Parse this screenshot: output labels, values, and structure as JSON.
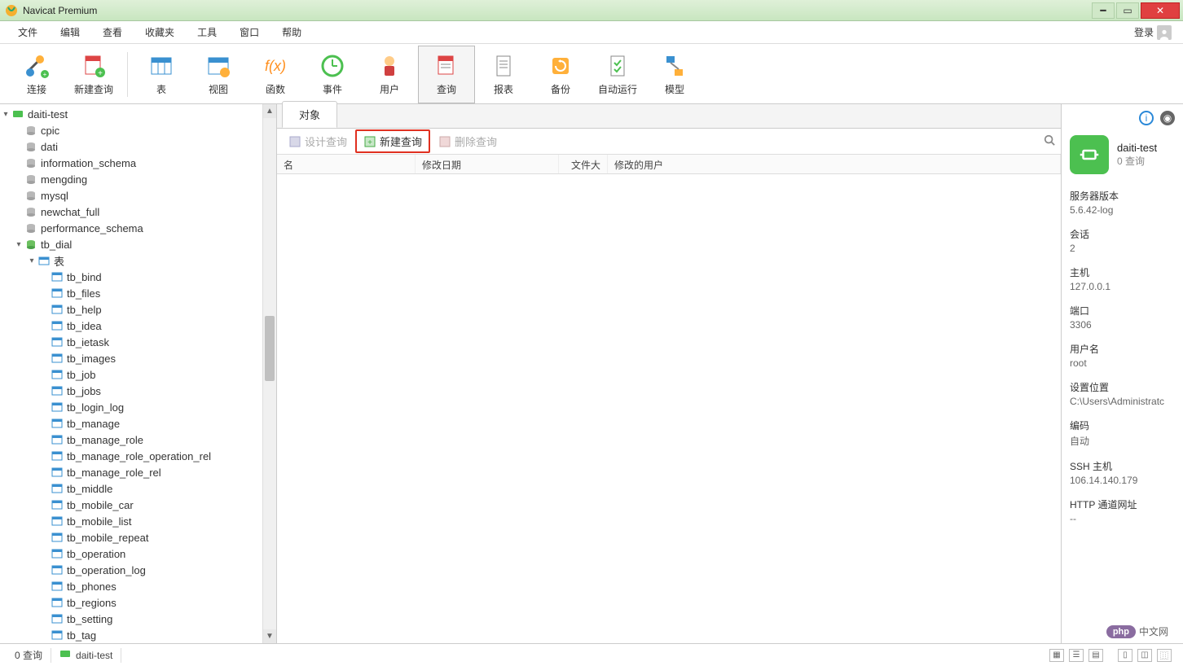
{
  "title": "Navicat Premium",
  "menu": [
    "文件",
    "编辑",
    "查看",
    "收藏夹",
    "工具",
    "窗口",
    "帮助"
  ],
  "login_label": "登录",
  "toolbar": [
    {
      "id": "connect",
      "label": "连接"
    },
    {
      "id": "new-query",
      "label": "新建查询"
    },
    {
      "id": "table",
      "label": "表"
    },
    {
      "id": "view",
      "label": "视图"
    },
    {
      "id": "function",
      "label": "函数"
    },
    {
      "id": "event",
      "label": "事件"
    },
    {
      "id": "user",
      "label": "用户"
    },
    {
      "id": "query",
      "label": "查询",
      "selected": true
    },
    {
      "id": "report",
      "label": "报表"
    },
    {
      "id": "backup",
      "label": "备份"
    },
    {
      "id": "auto",
      "label": "自动运行"
    },
    {
      "id": "model",
      "label": "模型"
    }
  ],
  "tree": {
    "connection": "daiti-test",
    "databases": [
      "cpic",
      "dati",
      "information_schema",
      "mengding",
      "mysql",
      "newchat_full",
      "performance_schema"
    ],
    "open_db": "tb_dial",
    "tables_label": "表",
    "tables": [
      "tb_bind",
      "tb_files",
      "tb_help",
      "tb_idea",
      "tb_ietask",
      "tb_images",
      "tb_job",
      "tb_jobs",
      "tb_login_log",
      "tb_manage",
      "tb_manage_role",
      "tb_manage_role_operation_rel",
      "tb_manage_role_rel",
      "tb_middle",
      "tb_mobile_car",
      "tb_mobile_list",
      "tb_mobile_repeat",
      "tb_operation",
      "tb_operation_log",
      "tb_phones",
      "tb_regions",
      "tb_setting",
      "tb_tag"
    ]
  },
  "objects_tab": "对象",
  "actions": {
    "design": "设计查询",
    "new": "新建查询",
    "delete": "删除查询"
  },
  "columns": {
    "name": "名",
    "mdate": "修改日期",
    "size": "文件大小",
    "user": "修改的用户"
  },
  "info": {
    "name": "daiti-test",
    "sub": "0 查询",
    "blocks": [
      {
        "k": "服务器版本",
        "v": "5.6.42-log"
      },
      {
        "k": "会话",
        "v": "2"
      },
      {
        "k": "主机",
        "v": "127.0.0.1"
      },
      {
        "k": "端口",
        "v": "3306"
      },
      {
        "k": "用户名",
        "v": "root"
      },
      {
        "k": "设置位置",
        "v": "C:\\Users\\Administratc"
      },
      {
        "k": "编码",
        "v": "自动"
      },
      {
        "k": "SSH 主机",
        "v": "106.14.140.179"
      },
      {
        "k": "HTTP 通道网址",
        "v": "--"
      }
    ]
  },
  "status": {
    "left": "0 查询",
    "conn": "daiti-test"
  },
  "watermark": {
    "badge": "php",
    "text": "中文网"
  }
}
